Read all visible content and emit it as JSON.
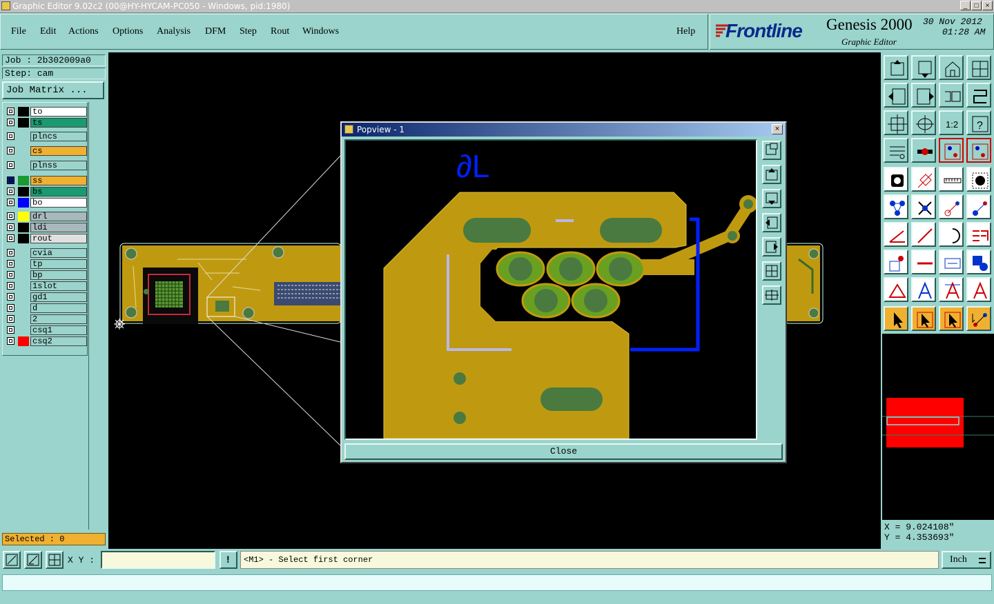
{
  "window": {
    "title": "Graphic Editor 9.02c2 (00@HY-HYCAM-PC050 - Windows, pid:1980)",
    "minimize": "_",
    "maximize": "□",
    "close": "×"
  },
  "menu": {
    "items": [
      "File",
      "Edit",
      "Actions",
      "Options",
      "Analysis",
      "DFM",
      "Step",
      "Rout",
      "Windows"
    ],
    "help": "Help"
  },
  "brand": {
    "logo": "Frontline",
    "product": "Genesis 2000",
    "subtitle": "Graphic Editor",
    "date": "30 Nov 2012",
    "time": "01:28 AM"
  },
  "job": {
    "job_label": "Job : 2b302009a0",
    "step_label": "Step: cam",
    "matrix_button": "Job Matrix ..."
  },
  "layers": [
    {
      "name": "to",
      "color": "#ffffff",
      "swatch": "#000000"
    },
    {
      "name": "ts",
      "color": "#1a9a70",
      "swatch": "#000000"
    },
    {
      "name": "plncs",
      "color": "#9ad4cc",
      "swatch": ""
    },
    {
      "name": "cs",
      "color": "#f0b030",
      "swatch": ""
    },
    {
      "name": "plnss",
      "color": "#9ad4cc",
      "swatch": ""
    },
    {
      "name": "ss",
      "color": "#f0b030",
      "swatch": "#1a9a30"
    },
    {
      "name": "bs",
      "color": "#1a9a70",
      "swatch": "#000000"
    },
    {
      "name": "bo",
      "color": "#ffffff",
      "swatch": "#0000ff"
    },
    {
      "name": "drl",
      "color": "#a8b8bc",
      "swatch": "#ffff00"
    },
    {
      "name": "ldi",
      "color": "#a8b8bc",
      "swatch": "#000000"
    },
    {
      "name": "rout",
      "color": "#e0e0e0",
      "swatch": "#000000"
    },
    {
      "name": "cvia",
      "color": "#9ad4cc",
      "swatch": ""
    },
    {
      "name": "tp",
      "color": "#9ad4cc",
      "swatch": ""
    },
    {
      "name": "bp",
      "color": "#9ad4cc",
      "swatch": ""
    },
    {
      "name": "1slot",
      "color": "#9ad4cc",
      "swatch": ""
    },
    {
      "name": "gd1",
      "color": "#9ad4cc",
      "swatch": ""
    },
    {
      "name": "d",
      "color": "#9ad4cc",
      "swatch": ""
    },
    {
      "name": "2",
      "color": "#9ad4cc",
      "swatch": ""
    },
    {
      "name": "csq1",
      "color": "#9ad4cc",
      "swatch": ""
    },
    {
      "name": "csq2",
      "color": "#9ad4cc",
      "swatch": "#ff0000"
    }
  ],
  "selected": "Selected : 0",
  "popview": {
    "title": "Popview - 1",
    "label": "∂L",
    "close_button": "Close"
  },
  "coords": {
    "x": "X = 9.024108\"",
    "y": "Y = 4.353693\""
  },
  "statusbar": {
    "xy_label": "X Y :",
    "prompt": "<M1> - Select first corner",
    "units": "Inch",
    "info_icon": "!"
  },
  "toolbar_icons": [
    "zoom-home-icon",
    "zoom-window-icon",
    "home-icon",
    "split-view-icon",
    "pan-left-icon",
    "pan-right-icon",
    "undo-icon",
    "redo-icon",
    "fit-icon",
    "center-icon",
    "ratio-icon",
    "help-icon",
    "measure-icon",
    "snap-icon",
    "net-icon",
    "layer-net-icon",
    "pad-icon",
    "draw-icon",
    "ruler-icon",
    "dot-icon",
    "node-icon",
    "cross-icon",
    "connect-icon",
    "route-icon",
    "angle-icon",
    "line-icon",
    "arc-icon",
    "flip-icon",
    "copy-icon",
    "minus-icon",
    "box-icon",
    "shape-icon",
    "triangle-icon",
    "text-a-icon",
    "text-a2-icon",
    "text-a3-icon",
    "pointer-icon",
    "select-icon",
    "move-icon",
    "route-select-icon"
  ],
  "colors": {
    "panel": "#9ad4cc",
    "copper": "#bf9a10",
    "pad": "#4a7a40",
    "outline": "#0000ff",
    "accent": "#f0b030"
  }
}
